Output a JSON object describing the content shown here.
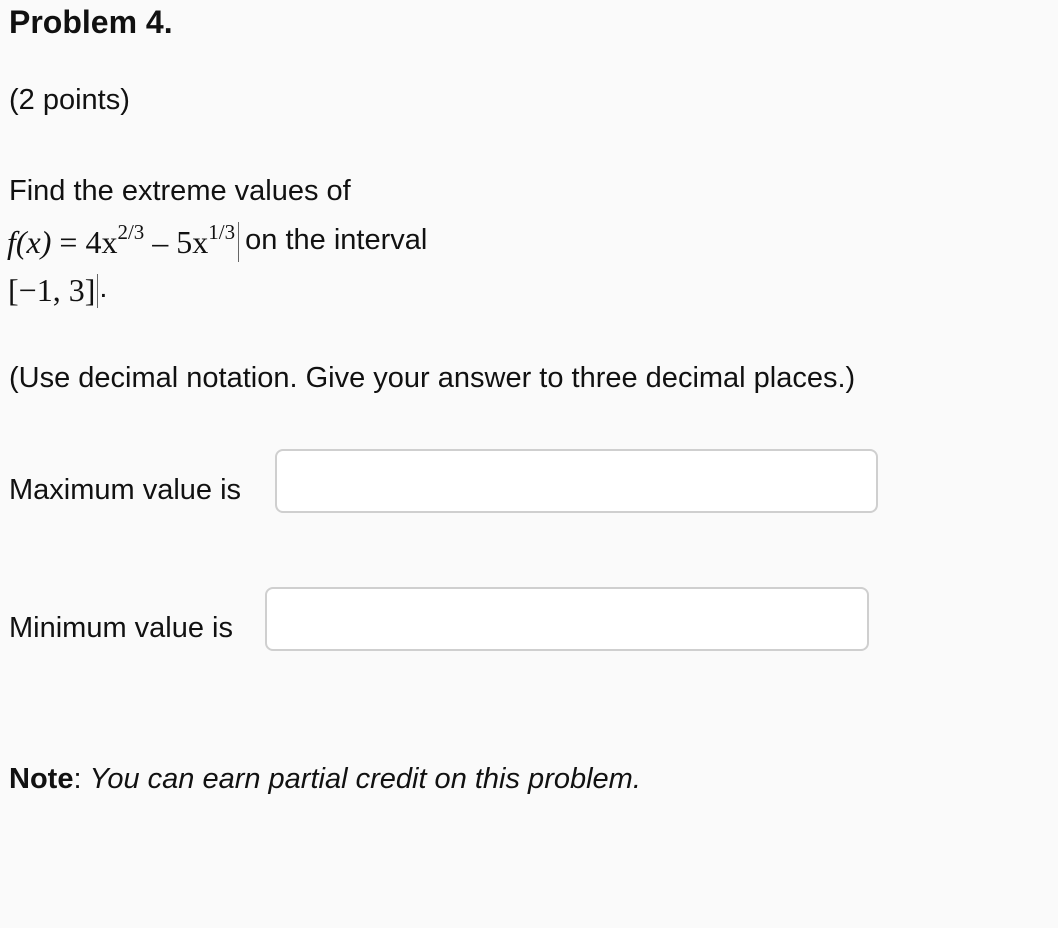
{
  "problem": {
    "title": "Problem 4.",
    "points": "(2 points)",
    "prompt": "Find the extreme values of",
    "function": {
      "fx": "f(x)",
      "equals": "=",
      "term1_base": "4x",
      "term1_exp": "2/3",
      "minus": "–",
      "term2_base": "5x",
      "term2_exp": "1/3"
    },
    "interval_text": "on the interval",
    "interval": "[−1,  3]",
    "interval_period": ".",
    "instructions": "(Use decimal notation. Give your answer to three decimal places.)"
  },
  "answers": {
    "max_label": "Maximum value is",
    "max_value": "",
    "min_label": "Minimum value is",
    "min_value": ""
  },
  "note": {
    "label": "Note",
    "colon": ":",
    "text": "You can earn partial credit on this problem."
  }
}
